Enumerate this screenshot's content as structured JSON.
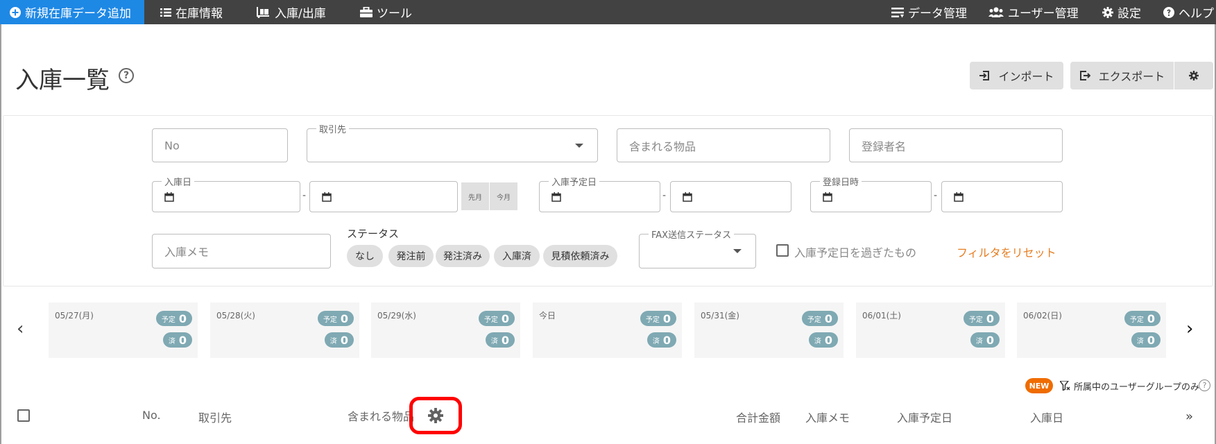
{
  "nav": {
    "new_stock": "新規在庫データ追加",
    "stock_info": "在庫情報",
    "in_out": "入庫/出庫",
    "tools": "ツール",
    "data_mgmt": "データ管理",
    "user_mgmt": "ユーザー管理",
    "settings": "設定",
    "help": "ヘルプ"
  },
  "page": {
    "title": "入庫一覧",
    "help_symbol": "?"
  },
  "actions": {
    "import": "インポート",
    "export": "エクスポート"
  },
  "filters": {
    "no_placeholder": "No",
    "supplier_label": "取引先",
    "items_placeholder": "含まれる物品",
    "registrant_placeholder": "登録者名",
    "received_date_label": "入庫日",
    "last_month": "先月",
    "this_month": "今月",
    "scheduled_date_label": "入庫予定日",
    "registered_at_label": "登録日時",
    "memo_placeholder": "入庫メモ",
    "status_label": "ステータス",
    "status_chips": [
      "なし",
      "発注前",
      "発注済み",
      "入庫済",
      "見積依頼済み"
    ],
    "fax_status_label": "FAX送信ステータス",
    "overdue_label": "入庫予定日を過ぎたもの",
    "reset": "フィルタをリセット",
    "dash": "-"
  },
  "calendar": {
    "planned_label": "予定",
    "done_label": "済",
    "days": [
      {
        "date": "05/27(月)",
        "planned": "0",
        "done": "0"
      },
      {
        "date": "05/28(火)",
        "planned": "0",
        "done": "0"
      },
      {
        "date": "05/29(水)",
        "planned": "0",
        "done": "0"
      },
      {
        "date": "今日",
        "planned": "0",
        "done": "0"
      },
      {
        "date": "05/31(金)",
        "planned": "0",
        "done": "0"
      },
      {
        "date": "06/01(土)",
        "planned": "0",
        "done": "0"
      },
      {
        "date": "06/02(日)",
        "planned": "0",
        "done": "0"
      }
    ]
  },
  "group_filter": {
    "new_badge": "NEW",
    "label": "所属中のユーザーグループのみ",
    "help_symbol": "?"
  },
  "table": {
    "headers": {
      "no": "No.",
      "supplier": "取引先",
      "items": "含まれる物品",
      "total": "合計金額",
      "memo": "入庫メモ",
      "scheduled": "入庫予定日",
      "received": "入庫日"
    }
  },
  "colors": {
    "topbar": "#424242",
    "primary": "#1e88e5",
    "badge": "#7fa9b3",
    "reset_link": "#e67e22",
    "new_badge": "#ef6c00",
    "highlight": "#ff0000"
  }
}
